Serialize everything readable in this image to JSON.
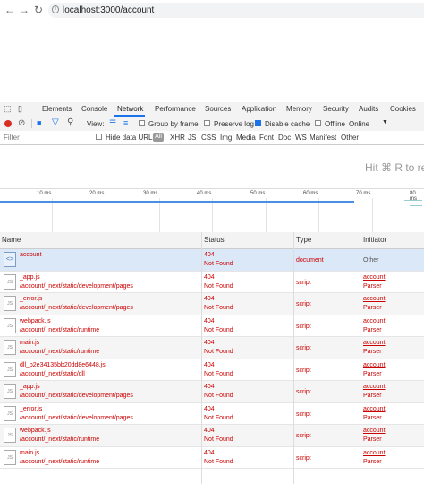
{
  "browser": {
    "back_icon": "arrow-left-icon",
    "forward_icon": "arrow-right-icon",
    "reload_icon": "reload-icon",
    "url": "localhost:3000/account"
  },
  "devtools": {
    "tabs": [
      "Elements",
      "Console",
      "Network",
      "Performance",
      "Sources",
      "Application",
      "Memory",
      "Security",
      "Audits",
      "Cookies"
    ],
    "active_tab": "Network",
    "toolbar": {
      "view_label": "View:",
      "group_by_frame": "Group by frame",
      "preserve_log": "Preserve log",
      "disable_cache": "Disable cache",
      "offline": "Offline",
      "online": "Online"
    },
    "filter": {
      "placeholder": "Filter",
      "hide_data_urls": "Hide data URLs",
      "types": [
        "All",
        "XHR",
        "JS",
        "CSS",
        "Img",
        "Media",
        "Font",
        "Doc",
        "WS",
        "Manifest",
        "Other"
      ]
    },
    "hint": "Hit ⌘ R to rel",
    "timeline_ticks": [
      "10 ms",
      "20 ms",
      "30 ms",
      "40 ms",
      "50 ms",
      "60 ms",
      "70 ms",
      "80 ms"
    ],
    "columns": {
      "name": "Name",
      "status": "Status",
      "type": "Type",
      "initiator": "Initiator"
    },
    "rows": [
      {
        "name": "account",
        "path": "",
        "code": "404",
        "status_text": "Not Found",
        "type": "document",
        "initiator": "Other",
        "initiator_sub": ""
      },
      {
        "name": "_app.js",
        "path": "/account/_next/static/development/pages",
        "code": "404",
        "status_text": "Not Found",
        "type": "script",
        "initiator": "account",
        "initiator_sub": "Parser"
      },
      {
        "name": "_error.js",
        "path": "/account/_next/static/development/pages",
        "code": "404",
        "status_text": "Not Found",
        "type": "script",
        "initiator": "account",
        "initiator_sub": "Parser"
      },
      {
        "name": "webpack.js",
        "path": "/account/_next/static/runtime",
        "code": "404",
        "status_text": "Not Found",
        "type": "script",
        "initiator": "account",
        "initiator_sub": "Parser"
      },
      {
        "name": "main.js",
        "path": "/account/_next/static/runtime",
        "code": "404",
        "status_text": "Not Found",
        "type": "script",
        "initiator": "account",
        "initiator_sub": "Parser"
      },
      {
        "name": "dll_b2e34135bb20dd8e6448.js",
        "path": "/account/_next/static/dll",
        "code": "404",
        "status_text": "Not Found",
        "type": "script",
        "initiator": "account",
        "initiator_sub": "Parser"
      },
      {
        "name": "_app.js",
        "path": "/account/_next/static/development/pages",
        "code": "404",
        "status_text": "Not Found",
        "type": "script",
        "initiator": "account",
        "initiator_sub": "Parser"
      },
      {
        "name": "_error.js",
        "path": "/account/_next/static/development/pages",
        "code": "404",
        "status_text": "Not Found",
        "type": "script",
        "initiator": "account",
        "initiator_sub": "Parser"
      },
      {
        "name": "webpack.js",
        "path": "/account/_next/static/runtime",
        "code": "404",
        "status_text": "Not Found",
        "type": "script",
        "initiator": "account",
        "initiator_sub": "Parser"
      },
      {
        "name": "main.js",
        "path": "/account/_next/static/runtime",
        "code": "404",
        "status_text": "Not Found",
        "type": "script",
        "initiator": "account",
        "initiator_sub": "Parser"
      }
    ],
    "colors": {
      "error": "#cc0000",
      "accent": "#1a73e8",
      "record": "#d93025"
    }
  }
}
